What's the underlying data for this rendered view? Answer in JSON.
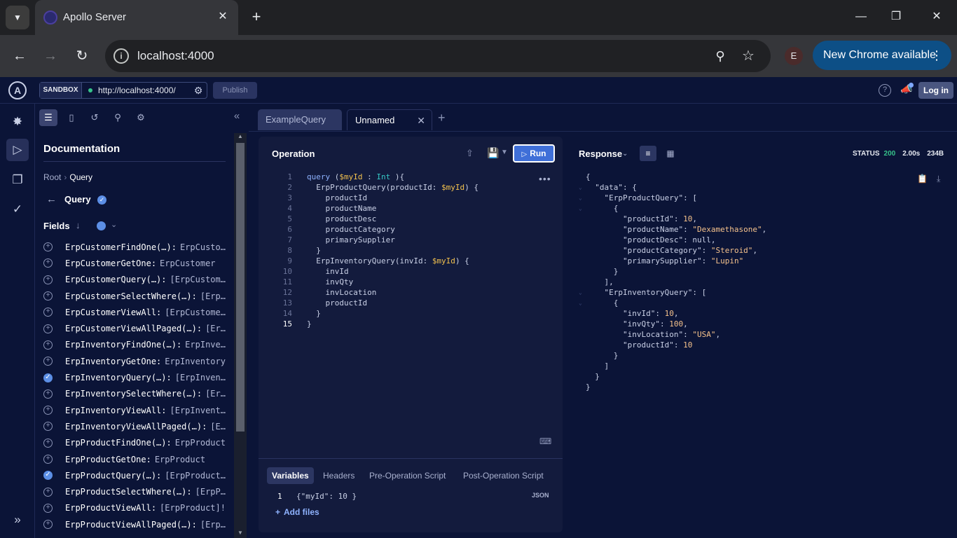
{
  "browser": {
    "tab_title": "Apollo Server",
    "url": "localhost:4000",
    "profile_initial": "E",
    "update_label": "New Chrome available"
  },
  "header": {
    "sandbox_label": "SANDBOX",
    "endpoint": "http://localhost:4000/",
    "publish_label": "Publish",
    "login_label": "Log in"
  },
  "docs": {
    "title": "Documentation",
    "breadcrumb_root": "Root",
    "breadcrumb_current": "Query",
    "section_title": "Query",
    "fields_label": "Fields",
    "fields": [
      {
        "name": "ErpCustomerFindOne(…):",
        "type": "ErpCusto…",
        "checked": false
      },
      {
        "name": "ErpCustomerGetOne:",
        "type": "ErpCustomer",
        "checked": false
      },
      {
        "name": "ErpCustomerQuery(…):",
        "type": "[ErpCustom…",
        "checked": false
      },
      {
        "name": "ErpCustomerSelectWhere(…):",
        "type": "[Erp…",
        "checked": false
      },
      {
        "name": "ErpCustomerViewAll:",
        "type": "[ErpCustome…",
        "checked": false
      },
      {
        "name": "ErpCustomerViewAllPaged(…):",
        "type": "[Er…",
        "checked": false
      },
      {
        "name": "ErpInventoryFindOne(…):",
        "type": "ErpInve…",
        "checked": false
      },
      {
        "name": "ErpInventoryGetOne:",
        "type": "ErpInventory",
        "checked": false
      },
      {
        "name": "ErpInventoryQuery(…):",
        "type": "[ErpInven…",
        "checked": true
      },
      {
        "name": "ErpInventorySelectWhere(…):",
        "type": "[Er…",
        "checked": false
      },
      {
        "name": "ErpInventoryViewAll:",
        "type": "[ErpInvent…",
        "checked": false
      },
      {
        "name": "ErpInventoryViewAllPaged(…):",
        "type": "[E…",
        "checked": false
      },
      {
        "name": "ErpProductFindOne(…):",
        "type": "ErpProduct",
        "checked": false
      },
      {
        "name": "ErpProductGetOne:",
        "type": "ErpProduct",
        "checked": false
      },
      {
        "name": "ErpProductQuery(…):",
        "type": "[ErpProduct…",
        "checked": true
      },
      {
        "name": "ErpProductSelectWhere(…):",
        "type": "[ErpP…",
        "checked": false
      },
      {
        "name": "ErpProductViewAll:",
        "type": "[ErpProduct]!",
        "checked": false
      },
      {
        "name": "ErpProductViewAllPaged(…):",
        "type": "[Erp…",
        "checked": false
      }
    ]
  },
  "editor": {
    "tabs": [
      "ExampleQuery",
      "Unnamed"
    ],
    "operation_title": "Operation",
    "run_label": "Run",
    "operation_lines": [
      {
        "n": "1",
        "tokens": [
          [
            "kw",
            "query "
          ],
          [
            "fn",
            "("
          ],
          [
            "var",
            "$myId"
          ],
          [
            "fn",
            " : "
          ],
          [
            "type",
            "Int"
          ],
          [
            "fn",
            " ){"
          ]
        ]
      },
      {
        "n": "2",
        "tokens": [
          [
            "fn",
            "  ErpProductQuery(productId: "
          ],
          [
            "var",
            "$myId"
          ],
          [
            "fn",
            ") {"
          ]
        ]
      },
      {
        "n": "3",
        "tokens": [
          [
            "fld",
            "    productId"
          ]
        ]
      },
      {
        "n": "4",
        "tokens": [
          [
            "fld",
            "    productName"
          ]
        ]
      },
      {
        "n": "5",
        "tokens": [
          [
            "fld",
            "    productDesc"
          ]
        ]
      },
      {
        "n": "6",
        "tokens": [
          [
            "fld",
            "    productCategory"
          ]
        ]
      },
      {
        "n": "7",
        "tokens": [
          [
            "fld",
            "    primarySupplier"
          ]
        ]
      },
      {
        "n": "8",
        "tokens": [
          [
            "fn",
            "  }"
          ]
        ]
      },
      {
        "n": "9",
        "tokens": [
          [
            "fn",
            "  ErpInventoryQuery(invId: "
          ],
          [
            "var",
            "$myId"
          ],
          [
            "fn",
            ") {"
          ]
        ]
      },
      {
        "n": "10",
        "tokens": [
          [
            "fld",
            "    invId"
          ]
        ]
      },
      {
        "n": "11",
        "tokens": [
          [
            "fld",
            "    invQty"
          ]
        ]
      },
      {
        "n": "12",
        "tokens": [
          [
            "fld",
            "    invLocation"
          ]
        ]
      },
      {
        "n": "13",
        "tokens": [
          [
            "fld",
            "    productId"
          ]
        ]
      },
      {
        "n": "14",
        "tokens": [
          [
            "fn",
            "  }"
          ]
        ]
      },
      {
        "n": "15",
        "tokens": [
          [
            "fn",
            "}"
          ]
        ]
      }
    ],
    "variables_tabs": [
      "Variables",
      "Headers",
      "Pre-Operation Script",
      "Post-Operation Script"
    ],
    "variables_line_number": "1",
    "variables_text": "{\"myId\": 10 }",
    "json_label": "JSON",
    "add_files_label": "Add files"
  },
  "response": {
    "title": "Response",
    "status_label": "STATUS",
    "status_code": "200",
    "duration": "2.00s",
    "size": "234B",
    "lines": [
      {
        "fold": false,
        "tokens": [
          [
            "fn",
            "{"
          ]
        ]
      },
      {
        "fold": true,
        "tokens": [
          [
            "key",
            "  \"data\""
          ],
          [
            "fn",
            ": {"
          ]
        ]
      },
      {
        "fold": true,
        "tokens": [
          [
            "key",
            "    \"ErpProductQuery\""
          ],
          [
            "fn",
            ": ["
          ]
        ]
      },
      {
        "fold": true,
        "tokens": [
          [
            "fn",
            "      {"
          ]
        ]
      },
      {
        "fold": false,
        "tokens": [
          [
            "key",
            "        \"productId\""
          ],
          [
            "fn",
            ": "
          ],
          [
            "num",
            "10"
          ],
          [
            "fn",
            ","
          ]
        ]
      },
      {
        "fold": false,
        "tokens": [
          [
            "key",
            "        \"productName\""
          ],
          [
            "fn",
            ": "
          ],
          [
            "str",
            "\"Dexamethasone\""
          ],
          [
            "fn",
            ","
          ]
        ]
      },
      {
        "fold": false,
        "tokens": [
          [
            "key",
            "        \"productDesc\""
          ],
          [
            "fn",
            ": "
          ],
          [
            "null",
            "null"
          ],
          [
            "fn",
            ","
          ]
        ]
      },
      {
        "fold": false,
        "tokens": [
          [
            "key",
            "        \"productCategory\""
          ],
          [
            "fn",
            ": "
          ],
          [
            "str",
            "\"Steroid\""
          ],
          [
            "fn",
            ","
          ]
        ]
      },
      {
        "fold": false,
        "tokens": [
          [
            "key",
            "        \"primarySupplier\""
          ],
          [
            "fn",
            ": "
          ],
          [
            "str",
            "\"Lupin\""
          ]
        ]
      },
      {
        "fold": false,
        "tokens": [
          [
            "fn",
            "      }"
          ]
        ]
      },
      {
        "fold": false,
        "tokens": [
          [
            "fn",
            "    ],"
          ]
        ]
      },
      {
        "fold": true,
        "tokens": [
          [
            "key",
            "    \"ErpInventoryQuery\""
          ],
          [
            "fn",
            ": ["
          ]
        ]
      },
      {
        "fold": true,
        "tokens": [
          [
            "fn",
            "      {"
          ]
        ]
      },
      {
        "fold": false,
        "tokens": [
          [
            "key",
            "        \"invId\""
          ],
          [
            "fn",
            ": "
          ],
          [
            "num",
            "10"
          ],
          [
            "fn",
            ","
          ]
        ]
      },
      {
        "fold": false,
        "tokens": [
          [
            "key",
            "        \"invQty\""
          ],
          [
            "fn",
            ": "
          ],
          [
            "num",
            "100"
          ],
          [
            "fn",
            ","
          ]
        ]
      },
      {
        "fold": false,
        "tokens": [
          [
            "key",
            "        \"invLocation\""
          ],
          [
            "fn",
            ": "
          ],
          [
            "str",
            "\"USA\""
          ],
          [
            "fn",
            ","
          ]
        ]
      },
      {
        "fold": false,
        "tokens": [
          [
            "key",
            "        \"productId\""
          ],
          [
            "fn",
            ": "
          ],
          [
            "num",
            "10"
          ]
        ]
      },
      {
        "fold": false,
        "tokens": [
          [
            "fn",
            "      }"
          ]
        ]
      },
      {
        "fold": false,
        "tokens": [
          [
            "fn",
            "    ]"
          ]
        ]
      },
      {
        "fold": false,
        "tokens": [
          [
            "fn",
            "  }"
          ]
        ]
      },
      {
        "fold": false,
        "tokens": [
          [
            "fn",
            "}"
          ]
        ]
      }
    ]
  },
  "colors": {
    "background": "#0b1437",
    "run_button": "#3f6fd8",
    "status_ok": "#36c28a",
    "chrome_update": "#0d4f86"
  }
}
